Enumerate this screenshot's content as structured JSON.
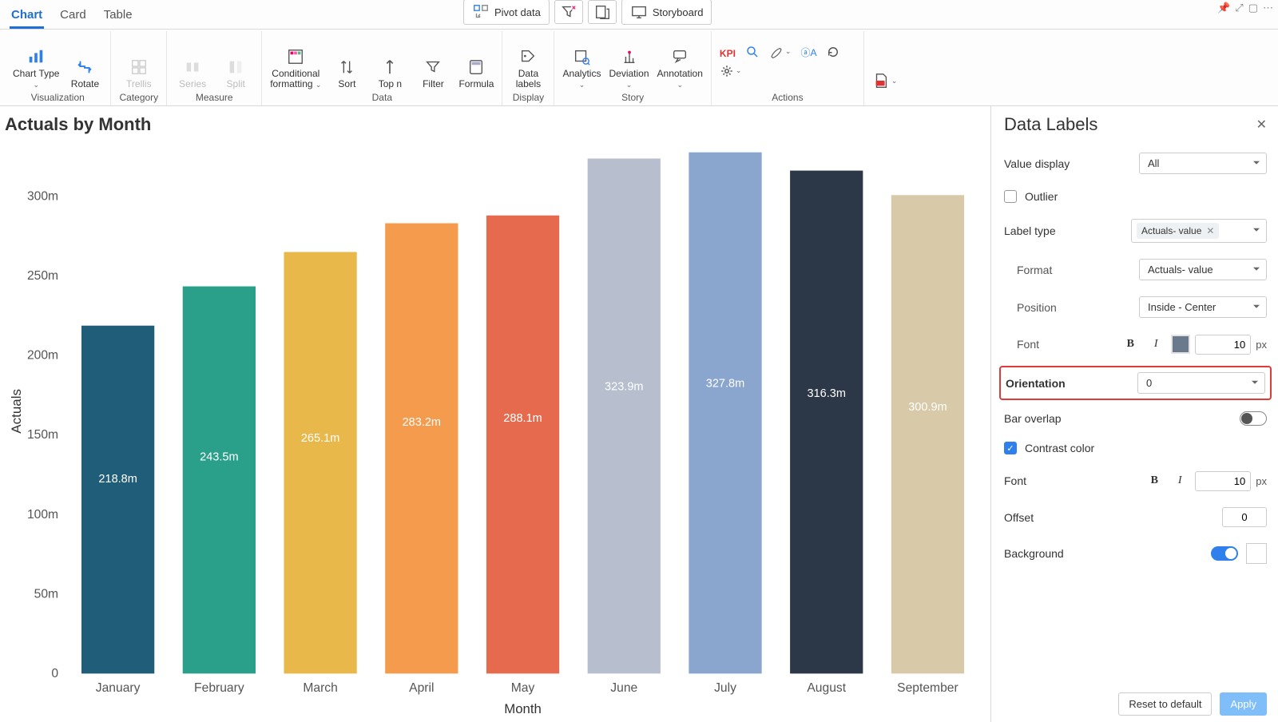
{
  "tabs": {
    "chart": "Chart",
    "card": "Card",
    "table": "Table"
  },
  "ribbon": {
    "chart_type": "Chart Type",
    "rotate": "Rotate",
    "visualization": "Visualization",
    "trellis": "Trellis",
    "category": "Category",
    "series": "Series",
    "split": "Split",
    "measure": "Measure",
    "conditional_formatting": "Conditional\nformatting",
    "sort": "Sort",
    "top_n": "Top n",
    "filter": "Filter",
    "formula": "Formula",
    "data": "Data",
    "data_labels": "Data\nlabels",
    "display": "Display",
    "analytics": "Analytics",
    "deviation": "Deviation",
    "annotation": "Annotation",
    "story": "Story",
    "kpi": "KPI",
    "actions": "Actions"
  },
  "pivot": {
    "pivot_data": "Pivot data",
    "storyboard": "Storyboard"
  },
  "chart_title": "Actuals by Month",
  "chart_data": {
    "type": "bar",
    "title": "Actuals by Month",
    "xlabel": "Month",
    "ylabel": "Actuals",
    "categories": [
      "January",
      "February",
      "March",
      "April",
      "May",
      "June",
      "July",
      "August",
      "September"
    ],
    "values": [
      218.8,
      243.5,
      265.1,
      283.2,
      288.1,
      323.9,
      327.8,
      316.3,
      300.9
    ],
    "value_unit_suffix": "m",
    "labels": [
      "218.8m",
      "243.5m",
      "265.1m",
      "283.2m",
      "288.1m",
      "323.9m",
      "327.8m",
      "316.3m",
      "300.9m"
    ],
    "colors": [
      "#1f5d78",
      "#2aa08b",
      "#e8b84a",
      "#f49b4d",
      "#e66a4d",
      "#b7bfce",
      "#8aa6cf",
      "#2c3747",
      "#d8c9a8"
    ],
    "ylim": [
      0,
      330
    ],
    "yticks": [
      0,
      50,
      100,
      150,
      200,
      250,
      300
    ],
    "ytick_labels": [
      "0",
      "50m",
      "100m",
      "150m",
      "200m",
      "250m",
      "300m"
    ]
  },
  "panel": {
    "title": "Data Labels",
    "value_display_label": "Value display",
    "value_display_value": "All",
    "outlier_label": "Outlier",
    "label_type_label": "Label type",
    "label_type_chip": "Actuals- value",
    "format_label": "Format",
    "format_value": "Actuals- value",
    "position_label": "Position",
    "position_value": "Inside - Center",
    "font_label": "Font",
    "font_size_value": "10",
    "font_size_unit": "px",
    "orientation_label": "Orientation",
    "orientation_value": "0",
    "bar_overlap_label": "Bar overlap",
    "contrast_label": "Contrast color",
    "font2_label": "Font",
    "font2_size_value": "10",
    "font2_size_unit": "px",
    "offset_label": "Offset",
    "offset_value": "0",
    "background_label": "Background",
    "reset": "Reset to default",
    "apply": "Apply"
  }
}
